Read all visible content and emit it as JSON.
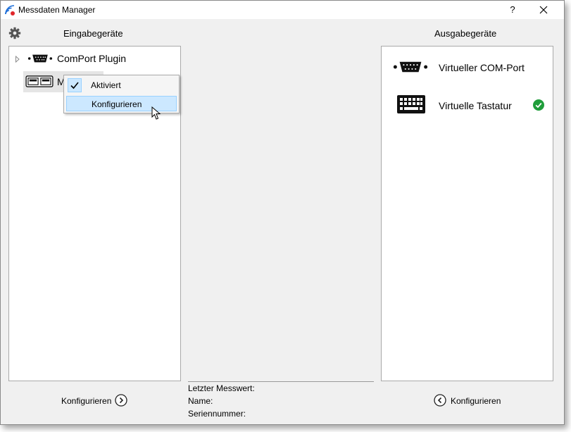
{
  "window": {
    "title": "Messdaten Manager",
    "help_label": "?",
    "close_label": "✕"
  },
  "inputs": {
    "heading": "Eingabegeräte",
    "tree": [
      {
        "label": "ComPort Plugin",
        "icon": "serial-port-icon"
      },
      {
        "label": "M",
        "icon": "usb-device-icon"
      }
    ],
    "context_menu": [
      {
        "label": "Aktiviert",
        "checked": true
      },
      {
        "label": "Konfigurieren",
        "highlighted": true
      }
    ],
    "configure_label": "Konfigurieren"
  },
  "info": {
    "last_value_label": "Letzter Messwert:",
    "name_label": "Name:",
    "serial_label": "Seriennummer:"
  },
  "outputs": {
    "heading": "Ausgabegeräte",
    "devices": [
      {
        "label": "Virtueller COM-Port",
        "icon": "serial-port-icon",
        "active": false
      },
      {
        "label": "Virtuelle Tastatur",
        "icon": "keyboard-icon",
        "active": true
      }
    ],
    "configure_label": "Konfigurieren"
  },
  "colors": {
    "accent_active": "#1f9d3a",
    "menu_highlight": "#cce8ff",
    "menu_highlight_border": "#99d1ff",
    "app_icon": "#1e6fd9"
  }
}
